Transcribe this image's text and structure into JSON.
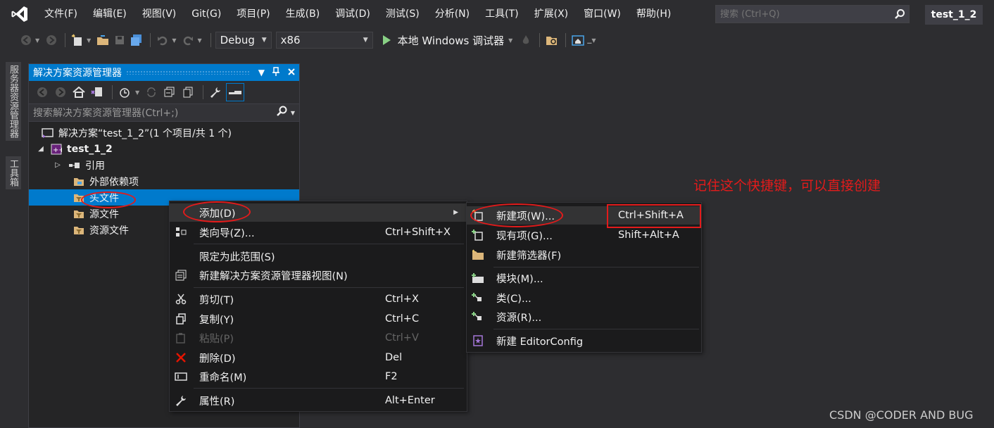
{
  "menubar": {
    "items": [
      "文件(F)",
      "编辑(E)",
      "视图(V)",
      "Git(G)",
      "项目(P)",
      "生成(B)",
      "调试(D)",
      "测试(S)",
      "分析(N)",
      "工具(T)",
      "扩展(X)",
      "窗口(W)",
      "帮助(H)"
    ],
    "search_placeholder": "搜索 (Ctrl+Q)",
    "project_title": "test_1_2"
  },
  "toolbar": {
    "config": "Debug",
    "platform": "x86",
    "run_label": "本地 Windows 调试器"
  },
  "side_tabs": [
    "服务器资源管理器",
    "工具箱"
  ],
  "solution_explorer": {
    "title": "解决方案资源管理器",
    "search_placeholder": "搜索解决方案资源管理器(Ctrl+;)",
    "tree": [
      {
        "label": "解决方案“test_1_2”(1 个项目/共 1 个)",
        "icon": "solution-icon"
      },
      {
        "label": "test_1_2",
        "icon": "project-icon",
        "expanded": true
      },
      {
        "label": "引用",
        "icon": "references-icon",
        "collapsed": true
      },
      {
        "label": "外部依赖项",
        "icon": "folder-icon"
      },
      {
        "label": "头文件",
        "icon": "filter-folder-icon",
        "selected": true
      },
      {
        "label": "源文件",
        "icon": "filter-folder-icon"
      },
      {
        "label": "资源文件",
        "icon": "filter-folder-icon"
      }
    ]
  },
  "context_menu": {
    "items": [
      {
        "label": "添加(D)",
        "shortcut": "",
        "icon": "",
        "submenu": true,
        "highlighted": true
      },
      {
        "label": "类向导(Z)...",
        "shortcut": "Ctrl+Shift+X",
        "icon": "class-wizard-icon"
      },
      {
        "label": "限定为此范围(S)",
        "shortcut": "",
        "icon": ""
      },
      {
        "label": "新建解决方案资源管理器视图(N)",
        "shortcut": "",
        "icon": "new-view-icon"
      },
      {
        "label": "剪切(T)",
        "shortcut": "Ctrl+X",
        "icon": "cut-icon"
      },
      {
        "label": "复制(Y)",
        "shortcut": "Ctrl+C",
        "icon": "copy-icon"
      },
      {
        "label": "粘贴(P)",
        "shortcut": "Ctrl+V",
        "icon": "paste-icon",
        "disabled": true
      },
      {
        "label": "删除(D)",
        "shortcut": "Del",
        "icon": "delete-icon"
      },
      {
        "label": "重命名(M)",
        "shortcut": "F2",
        "icon": "rename-icon"
      },
      {
        "label": "属性(R)",
        "shortcut": "Alt+Enter",
        "icon": "wrench-icon"
      }
    ]
  },
  "submenu": {
    "items": [
      {
        "label": "新建项(W)...",
        "shortcut": "Ctrl+Shift+A",
        "icon": "new-item-icon",
        "highlighted": true
      },
      {
        "label": "现有项(G)...",
        "shortcut": "Shift+Alt+A",
        "icon": "existing-item-icon"
      },
      {
        "label": "新建筛选器(F)",
        "shortcut": "",
        "icon": "new-filter-icon"
      },
      {
        "label": "模块(M)...",
        "shortcut": "",
        "icon": "module-icon"
      },
      {
        "label": "类(C)...",
        "shortcut": "",
        "icon": "class-icon"
      },
      {
        "label": "资源(R)...",
        "shortcut": "",
        "icon": "resource-icon"
      },
      {
        "label": "新建 EditorConfig",
        "shortcut": "",
        "icon": "editorconfig-icon"
      }
    ]
  },
  "annotation_text": "记住这个快捷键，可以直接创建",
  "watermark": "CSDN @CODER AND BUG",
  "colors": {
    "accent": "#007acc",
    "annotation": "#e31b1b",
    "background": "#2d2d30"
  }
}
